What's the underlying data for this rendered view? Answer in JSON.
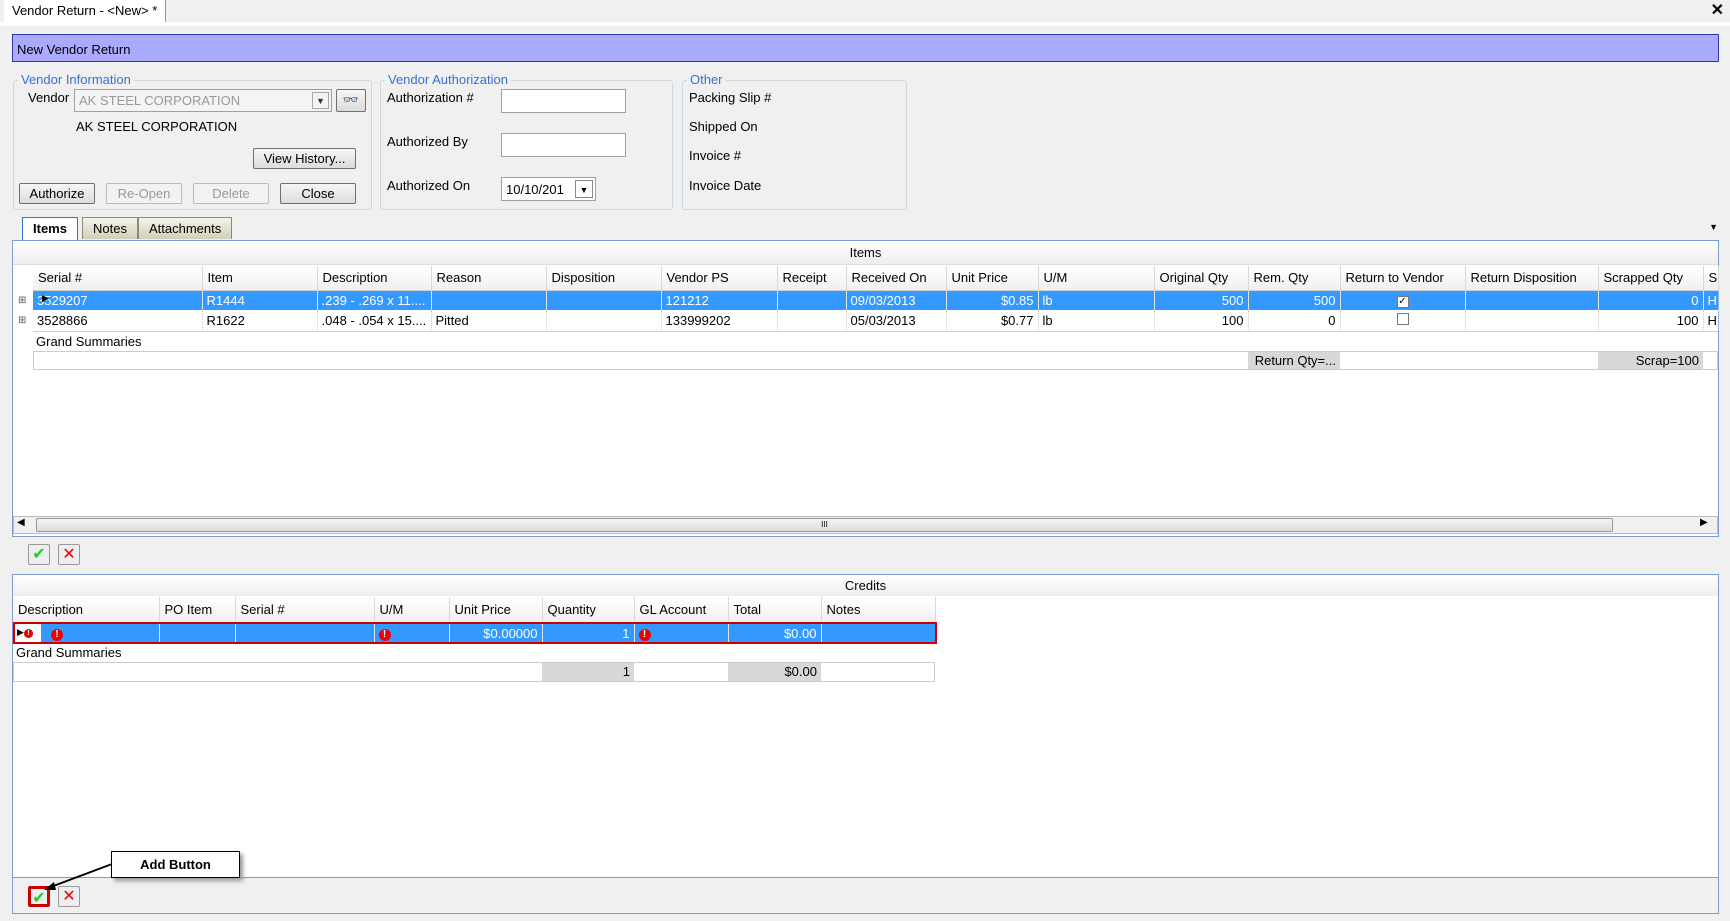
{
  "window": {
    "tab_title": "Vendor Return - <New> *",
    "close": "✕"
  },
  "header": {
    "title": "New Vendor Return"
  },
  "vendor_info": {
    "title": "Vendor Information",
    "vendor_label": "Vendor",
    "vendor_value": "AK STEEL CORPORATION",
    "vendor_name": "AK STEEL CORPORATION",
    "view_history": "View History...",
    "buttons": {
      "authorize": "Authorize",
      "reopen": "Re-Open",
      "delete": "Delete",
      "close": "Close"
    }
  },
  "vendor_auth": {
    "title": "Vendor Authorization",
    "auth_num_label": "Authorization #",
    "auth_num_value": "",
    "auth_by_label": "Authorized By",
    "auth_by_value": "",
    "auth_on_label": "Authorized On",
    "auth_on_value": "10/10/201"
  },
  "other": {
    "title": "Other",
    "packing_slip": "Packing Slip #",
    "shipped_on": "Shipped On",
    "invoice_num": "Invoice #",
    "invoice_date": "Invoice Date"
  },
  "tabs": [
    {
      "label": "Items",
      "active": true
    },
    {
      "label": "Notes"
    },
    {
      "label": "Attachments"
    }
  ],
  "items": {
    "title": "Items",
    "columns": [
      "Serial #",
      "Item",
      "Description",
      "Reason",
      "Disposition",
      "Vendor PS",
      "Receipt",
      "Received On",
      "Unit Price",
      "U/M",
      "Original Qty",
      "Rem. Qty",
      "Return to Vendor",
      "Return Disposition",
      "Scrapped Qty",
      "S"
    ],
    "rows": [
      [
        "3529207",
        "R1444",
        ".239 - .269 x 11....",
        "",
        "",
        "121212",
        "",
        "09/03/2013",
        "$0.85",
        "lb",
        "500",
        "500",
        true,
        "",
        "0",
        "H"
      ],
      [
        "3528866",
        "R1622",
        ".048 - .054  x 15....",
        "Pitted",
        "",
        "133999202",
        "",
        "05/03/2013",
        "$0.77",
        "lb",
        "100",
        "0",
        false,
        "",
        "100",
        "H"
      ]
    ],
    "selected_row": 0,
    "grand_summaries": "Grand Summaries",
    "return_qty_summary": "Return Qty=...",
    "scrap_summary": "Scrap=100",
    "scroll_thumb": "III"
  },
  "credits": {
    "title": "Credits",
    "columns": [
      "Description",
      "PO Item",
      "Serial #",
      "U/M",
      "Unit Price",
      "Quantity",
      "GL Account",
      "Total",
      "Notes"
    ],
    "rows": [
      [
        "",
        "",
        "",
        "",
        "$0.00000",
        "1",
        "",
        "$0.00",
        ""
      ]
    ],
    "grand_summaries": "Grand Summaries",
    "qty_sum": "1",
    "total_sum": "$0.00"
  },
  "callout": {
    "text": "Add Button"
  },
  "colors": {
    "header": "#aaaaff",
    "selection": "#3399ff",
    "highlight": "#cc0000"
  }
}
